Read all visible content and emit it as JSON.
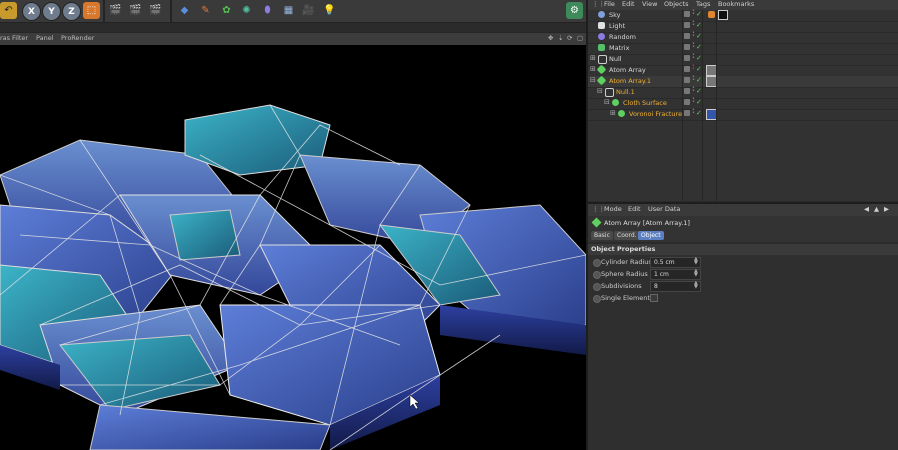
{
  "toolbar": {
    "buttons": [
      {
        "name": "undo-icon",
        "glyph": "↶"
      },
      {
        "name": "x-axis-button",
        "glyph": "X"
      },
      {
        "name": "y-axis-button",
        "glyph": "Y"
      },
      {
        "name": "z-axis-button",
        "glyph": "Z"
      },
      {
        "name": "coordinate-system-icon",
        "glyph": "⬚"
      },
      {
        "name": "render-view-icon",
        "glyph": "🎬"
      },
      {
        "name": "render-picture-viewer-icon",
        "glyph": "🎬"
      },
      {
        "name": "render-settings-icon",
        "glyph": "🎬"
      },
      {
        "name": "cube-icon",
        "glyph": "◆"
      },
      {
        "name": "pen-icon",
        "glyph": "✎"
      },
      {
        "name": "subdivision-icon",
        "glyph": "✿"
      },
      {
        "name": "array-icon",
        "glyph": "✺"
      },
      {
        "name": "deformer-icon",
        "glyph": "⬮"
      },
      {
        "name": "floor-icon",
        "glyph": "▦"
      },
      {
        "name": "camera-icon",
        "glyph": "🎥"
      },
      {
        "name": "light-icon",
        "glyph": "💡"
      }
    ]
  },
  "viewport": {
    "menu": [
      "ras",
      "Filter",
      "Panel",
      "ProRender"
    ]
  },
  "object_manager": {
    "menu": [
      "File",
      "Edit",
      "View",
      "Objects",
      "Tags",
      "Bookmarks"
    ],
    "rows": [
      {
        "name": "Sky",
        "color": "#d6d6d6",
        "icon_color": "#7fa0d8",
        "indent": 0
      },
      {
        "name": "Light",
        "color": "#d6d6d6",
        "icon_color": "#e0e0e0",
        "indent": 0
      },
      {
        "name": "Random",
        "color": "#d6d6d6",
        "icon_color": "#8c7be0",
        "indent": 0
      },
      {
        "name": "Matrix",
        "color": "#d6d6d6",
        "icon_color": "#55c06a",
        "indent": 0
      },
      {
        "name": "Null",
        "color": "#d6d6d6",
        "icon_color": "#cfcfcf",
        "indent": 0
      },
      {
        "name": "Atom Array",
        "color": "#d6d6d6",
        "icon_color": "#5fcf5f",
        "indent": 0
      },
      {
        "name": "Atom Array.1",
        "color": "#f0b030",
        "icon_color": "#5fcf5f",
        "indent": 0
      },
      {
        "name": "Null.1",
        "color": "#f0b030",
        "icon_color": "#cfcfcf",
        "indent": 1
      },
      {
        "name": "Cloth Surface",
        "color": "#f0b030",
        "icon_color": "#5fcf5f",
        "indent": 2
      },
      {
        "name": "Voronoi Fracture",
        "color": "#f0b030",
        "icon_color": "#5fcf5f",
        "indent": 3
      }
    ]
  },
  "attribute_manager": {
    "menu": [
      "Mode",
      "Edit",
      "User Data"
    ],
    "title": "Atom Array [Atom Array.1]",
    "tabs": [
      "Basic",
      "Coord.",
      "Object"
    ],
    "active_tab": "Object",
    "section": "Object Properties",
    "properties": [
      {
        "label": "Cylinder Radius",
        "value": "0.5 cm"
      },
      {
        "label": "Sphere Radius",
        "value": "1 cm"
      },
      {
        "label": "Subdivisions",
        "value": "8"
      },
      {
        "label": "Single Elements",
        "value": ""
      }
    ]
  }
}
